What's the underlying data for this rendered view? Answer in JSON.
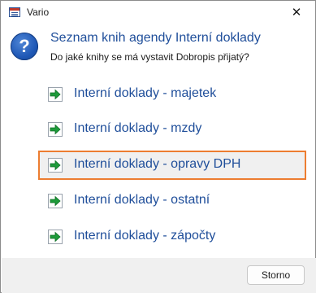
{
  "window": {
    "title": "Vario",
    "close_glyph": "✕"
  },
  "dialog": {
    "icon": "question-icon",
    "icon_glyph": "?",
    "heading": "Seznam knih agendy Interní doklady",
    "prompt": "Do jaké knihy se má vystavit Dobropis přijatý?"
  },
  "options": [
    {
      "label": "Interní doklady - majetek",
      "icon": "green-arrow-icon",
      "selected": false
    },
    {
      "label": "Interní doklady - mzdy",
      "icon": "green-arrow-icon",
      "selected": false
    },
    {
      "label": "Interní doklady - opravy DPH",
      "icon": "green-arrow-icon",
      "selected": true
    },
    {
      "label": "Interní doklady - ostatní",
      "icon": "green-arrow-icon",
      "selected": false
    },
    {
      "label": "Interní doklady - zápočty",
      "icon": "green-arrow-icon",
      "selected": false
    }
  ],
  "footer": {
    "cancel_label": "Storno"
  },
  "colors": {
    "link_blue": "#1f4e9a",
    "selection_border": "#ed7d31",
    "arrow_green": "#1e9b3a"
  }
}
